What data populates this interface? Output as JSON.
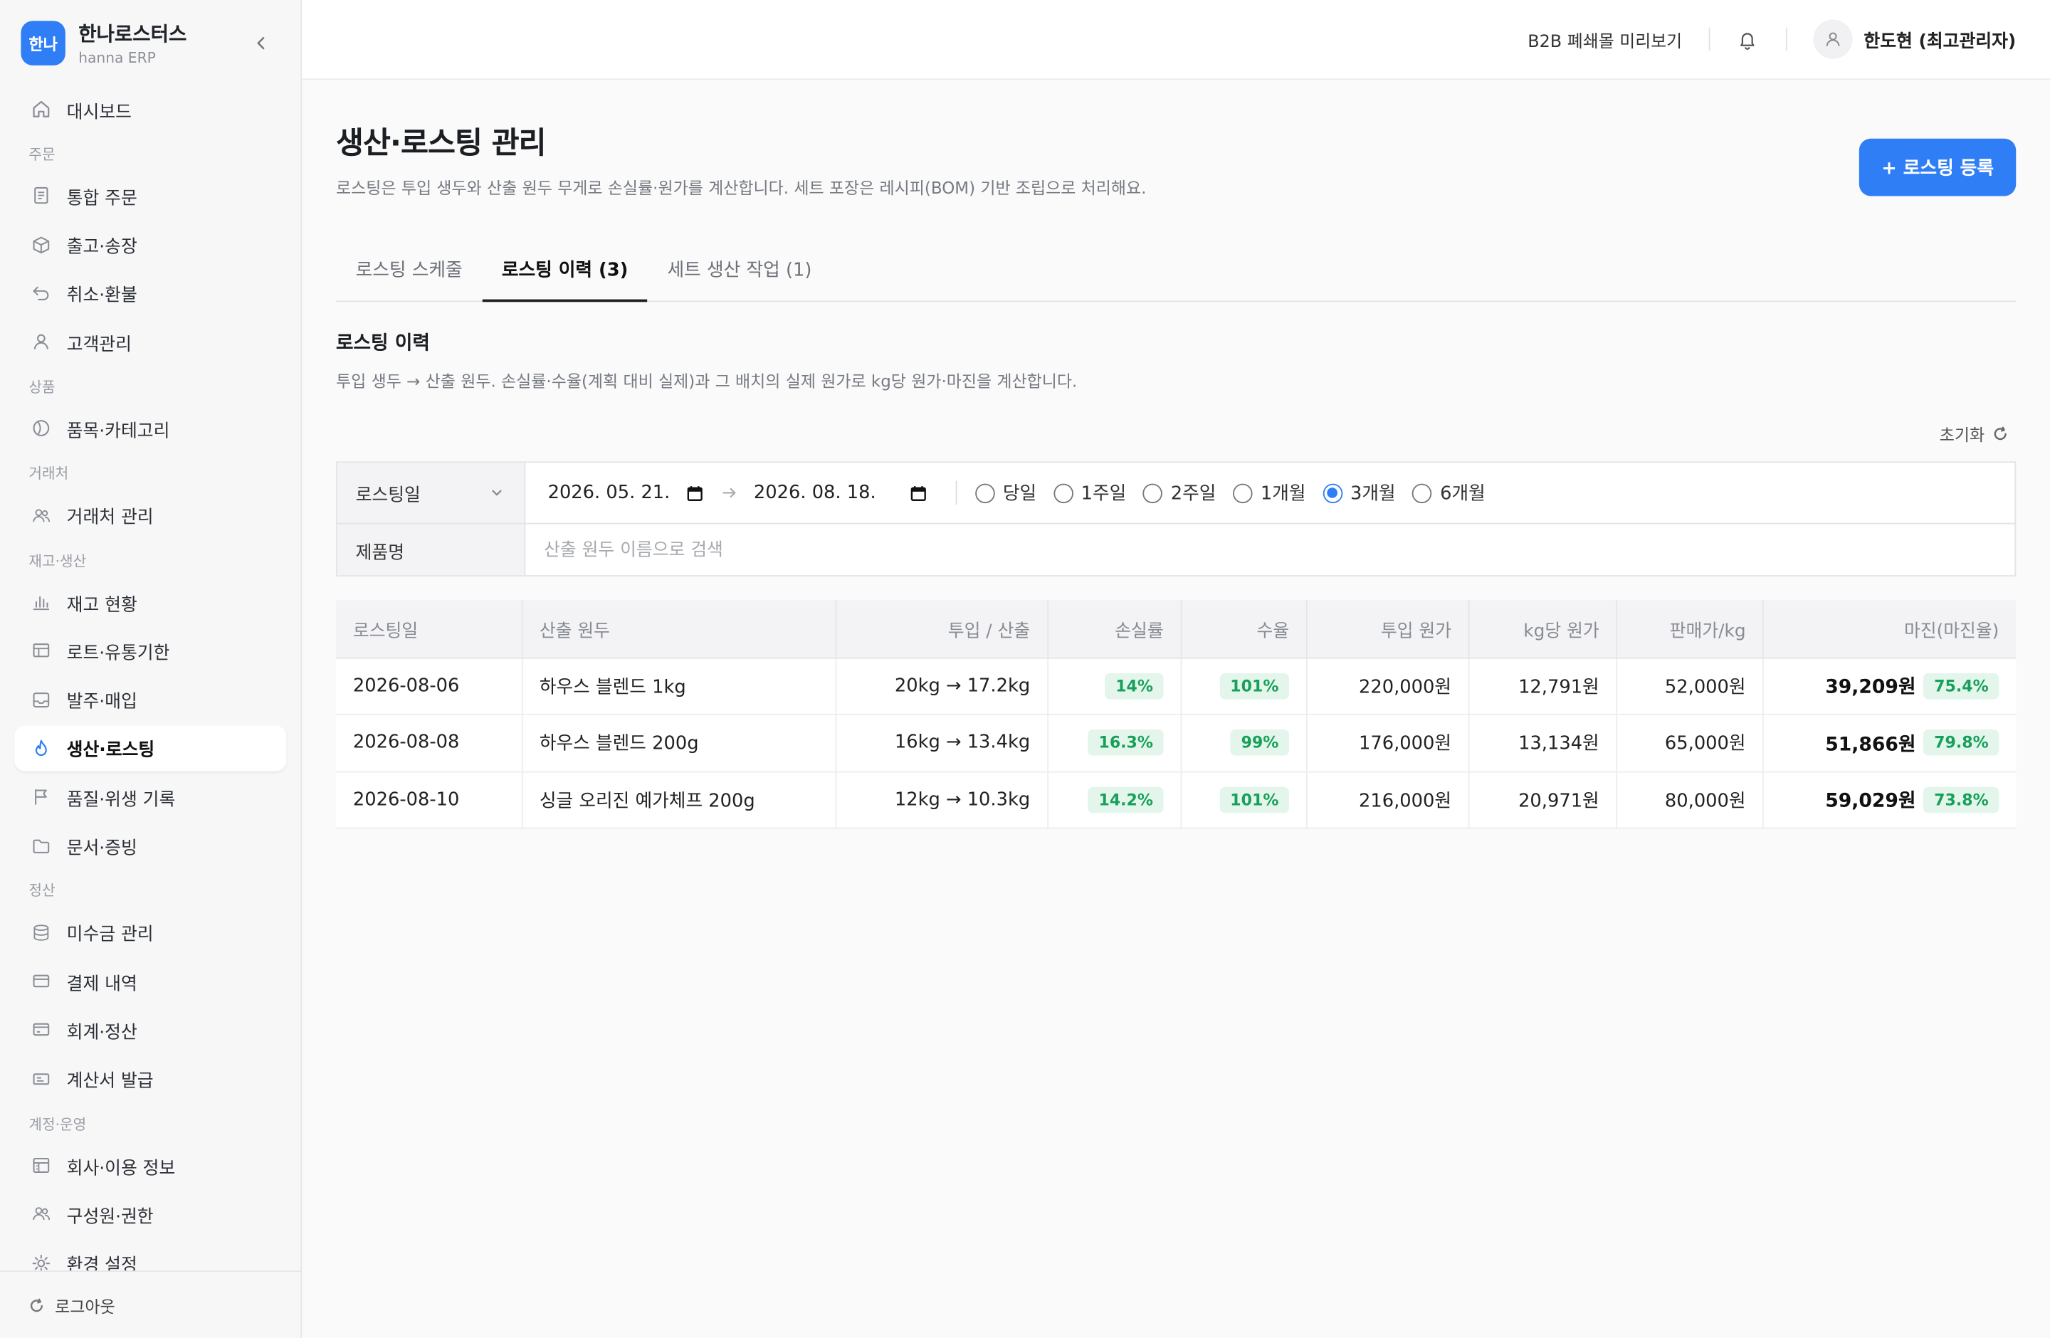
{
  "brand": {
    "logo": "한나",
    "name": "한나로스터스",
    "sub": "hanna ERP"
  },
  "sidebar": {
    "dashboard": "대시보드",
    "sections": [
      {
        "title": "주문",
        "items": [
          {
            "label": "통합 주문",
            "icon": "document-icon"
          },
          {
            "label": "출고·송장",
            "icon": "box-icon"
          },
          {
            "label": "취소·환불",
            "icon": "undo-icon"
          },
          {
            "label": "고객관리",
            "icon": "user-icon"
          }
        ]
      },
      {
        "title": "상품",
        "items": [
          {
            "label": "품목·카테고리",
            "icon": "tag-icon"
          }
        ]
      },
      {
        "title": "거래처",
        "items": [
          {
            "label": "거래처 관리",
            "icon": "users-icon"
          }
        ]
      },
      {
        "title": "재고·생산",
        "items": [
          {
            "label": "재고 현황",
            "icon": "bar-chart-icon"
          },
          {
            "label": "로트·유통기한",
            "icon": "table-icon"
          },
          {
            "label": "발주·매입",
            "icon": "inbox-icon"
          },
          {
            "label": "생산·로스팅",
            "icon": "flame-icon",
            "active": true
          },
          {
            "label": "품질·위생 기록",
            "icon": "flag-icon"
          },
          {
            "label": "문서·증빙",
            "icon": "folder-icon"
          }
        ]
      },
      {
        "title": "정산",
        "items": [
          {
            "label": "미수금 관리",
            "icon": "database-icon"
          },
          {
            "label": "결제 내역",
            "icon": "wallet-icon"
          },
          {
            "label": "회계·정산",
            "icon": "credit-card-icon"
          },
          {
            "label": "계산서 발급",
            "icon": "receipt-icon"
          }
        ]
      },
      {
        "title": "계정·운영",
        "items": [
          {
            "label": "회사·이용 정보",
            "icon": "building-icon"
          },
          {
            "label": "구성원·권한",
            "icon": "team-icon"
          },
          {
            "label": "환경 설정",
            "icon": "sun-gear-icon"
          }
        ]
      }
    ],
    "logout": "로그아웃"
  },
  "topbar": {
    "b2b_link": "B2B 폐쇄몰 미리보기",
    "user_name": "한도현 (최고관리자)"
  },
  "page": {
    "title": "생산·로스팅 관리",
    "desc": "로스팅은 투입 생두와 산출 원두 무게로 손실률·원가를 계산합니다. 세트 포장은 레시피(BOM) 기반 조립으로 처리해요.",
    "primary_button": "+ 로스팅 등록",
    "tabs": [
      "로스팅 스케줄",
      "로스팅 이력 (3)",
      "세트 생산 작업 (1)"
    ],
    "active_tab": 1
  },
  "section": {
    "title": "로스팅 이력",
    "desc": "투입 생두 → 산출 원두. 손실률·수율(계획 대비 실제)과 그 배치의 실제 원가로 kg당 원가·마진을 계산합니다."
  },
  "filter": {
    "reset": "초기화",
    "date_label": "로스팅일",
    "date_from": "2026. 05. 21.",
    "date_to": "2026. 08. 18.",
    "periods": [
      "당일",
      "1주일",
      "2주일",
      "1개월",
      "3개월",
      "6개월"
    ],
    "selected_period": "3개월",
    "product_label": "제품명",
    "product_placeholder": "산출 원두 이름으로 검색"
  },
  "table": {
    "headers": [
      "로스팅일",
      "산출 원두",
      "투입 / 산출",
      "손실률",
      "수율",
      "투입 원가",
      "kg당 원가",
      "판매가/kg",
      "마진(마진율)"
    ],
    "rows": [
      {
        "date": "2026-08-06",
        "product": "하우스 블렌드 1kg",
        "io": "20kg → 17.2kg",
        "loss": "14%",
        "yield": "101%",
        "input_cost": "220,000원",
        "kg_cost": "12,791원",
        "price": "52,000원",
        "margin": "39,209원",
        "margin_rate": "75.4%"
      },
      {
        "date": "2026-08-08",
        "product": "하우스 블렌드 200g",
        "io": "16kg → 13.4kg",
        "loss": "16.3%",
        "yield": "99%",
        "input_cost": "176,000원",
        "kg_cost": "13,134원",
        "price": "65,000원",
        "margin": "51,866원",
        "margin_rate": "79.8%"
      },
      {
        "date": "2026-08-10",
        "product": "싱글 오리진 예가체프 200g",
        "io": "12kg → 10.3kg",
        "loss": "14.2%",
        "yield": "101%",
        "input_cost": "216,000원",
        "kg_cost": "20,971원",
        "price": "80,000원",
        "margin": "59,029원",
        "margin_rate": "73.8%"
      }
    ]
  },
  "colors": {
    "accent": "#2f7ef6",
    "badge_green": "#17a05a",
    "badge_bg": "#e4f6ec"
  }
}
